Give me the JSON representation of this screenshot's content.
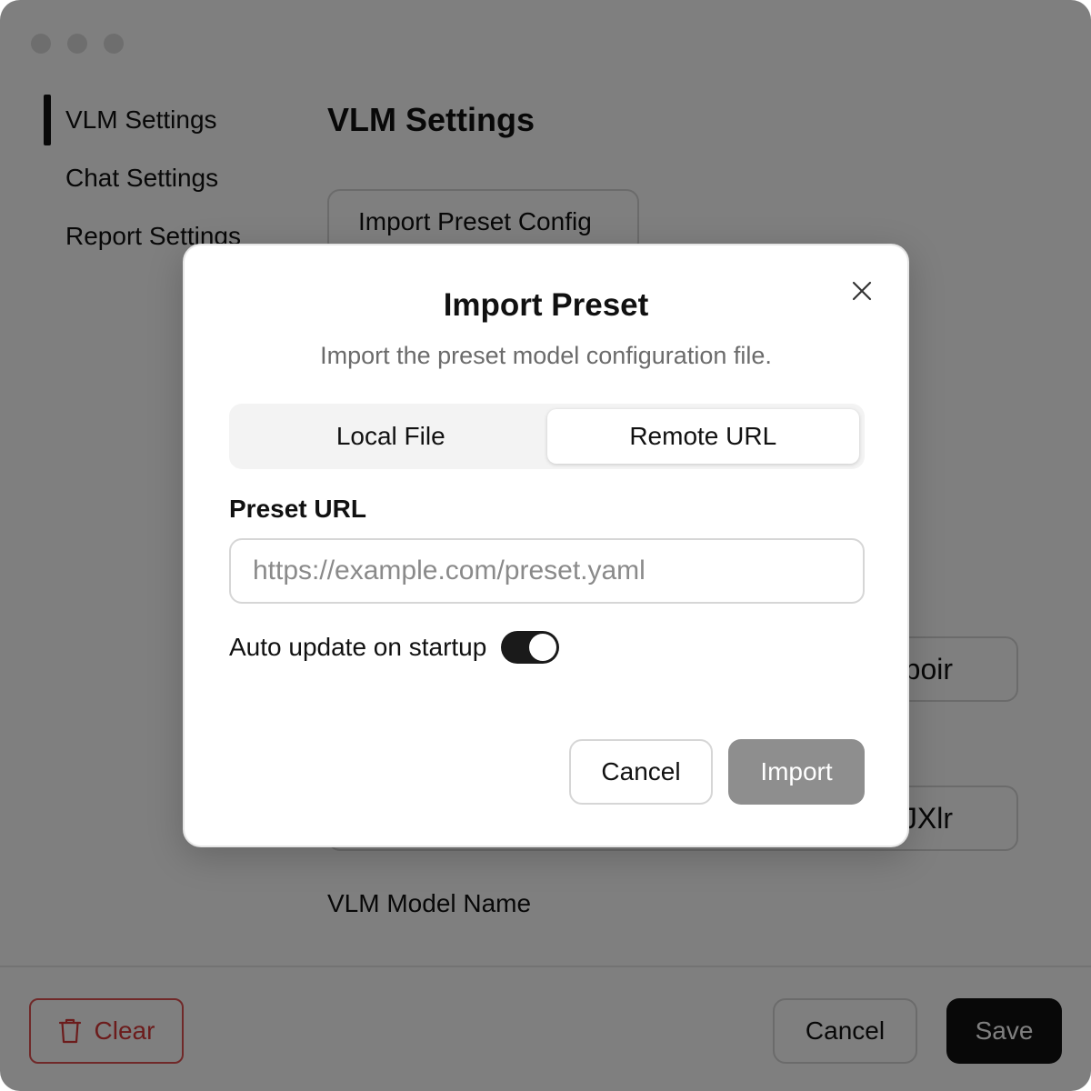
{
  "sidebar": {
    "items": [
      {
        "label": "VLM Settings"
      },
      {
        "label": "Chat Settings"
      },
      {
        "label": "Report Settings"
      }
    ]
  },
  "main": {
    "title": "VLM Settings",
    "import_preset_button": "Import Preset Config",
    "partial_input_a": "ndpoir",
    "partial_input_b": "JXlr",
    "model_name_label": "VLM Model Name"
  },
  "footer": {
    "clear_label": "Clear",
    "cancel_label": "Cancel",
    "save_label": "Save"
  },
  "modal": {
    "title": "Import Preset",
    "subtitle": "Import the preset model configuration file.",
    "tabs": [
      {
        "label": "Local File",
        "active": false
      },
      {
        "label": "Remote URL",
        "active": true
      }
    ],
    "url_label": "Preset URL",
    "url_placeholder": "https://example.com/preset.yaml",
    "url_value": "",
    "auto_update_label": "Auto update on startup",
    "auto_update_on": true,
    "cancel_label": "Cancel",
    "import_label": "Import"
  },
  "icons": {
    "close": "close-icon",
    "trash": "trash-icon"
  },
  "colors": {
    "danger": "#d93838",
    "primary": "#111111",
    "disabled": "#8e8e8e"
  }
}
